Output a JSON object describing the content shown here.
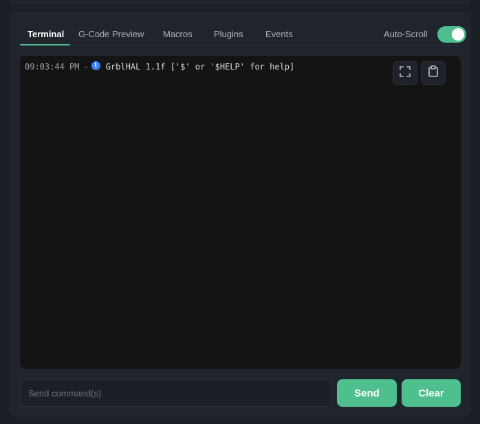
{
  "tabs": [
    {
      "label": "Terminal",
      "active": true
    },
    {
      "label": "G-Code Preview",
      "active": false
    },
    {
      "label": "Macros",
      "active": false
    },
    {
      "label": "Plugins",
      "active": false
    },
    {
      "label": "Events",
      "active": false
    }
  ],
  "autoscroll": {
    "label": "Auto-Scroll",
    "enabled": true
  },
  "terminal": {
    "lines": [
      {
        "time": "09:03:44 PM",
        "separator": "-",
        "level_icon": "info-icon",
        "message": "GrblHAL 1.1f ['$' or '$HELP' for help]"
      }
    ],
    "actions": {
      "expand_icon": "expand-icon",
      "copy_icon": "clipboard-icon"
    }
  },
  "command": {
    "placeholder": "Send command(s)",
    "value": ""
  },
  "buttons": {
    "send": "Send",
    "clear": "Clear"
  },
  "colors": {
    "accent": "#4fbf8f",
    "info": "#3b82f6",
    "background": "#1b1f26",
    "panel": "#20252d",
    "terminal": "#141414"
  }
}
